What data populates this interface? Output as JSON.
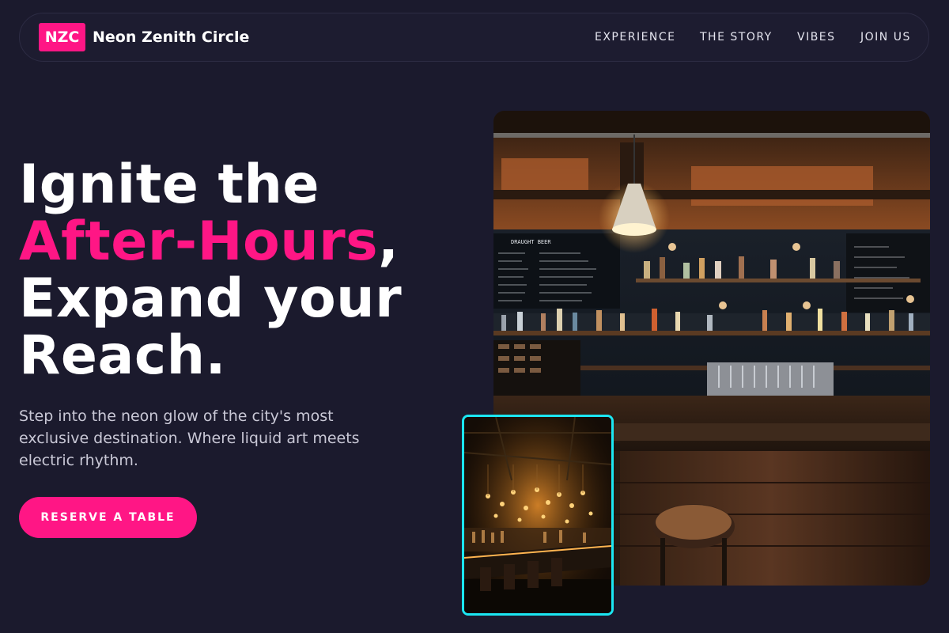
{
  "nav": {
    "logo_badge": "NZC",
    "brand_name": "Neon Zenith Circle",
    "links": [
      {
        "label": "EXPERIENCE"
      },
      {
        "label": "THE STORY"
      },
      {
        "label": "VIBES"
      },
      {
        "label": "JOIN US"
      }
    ]
  },
  "hero": {
    "headline_line1": "Ignite the",
    "headline_accent": "After-Hours",
    "headline_comma": ",",
    "headline_line3": "Expand your",
    "headline_line4": "Reach.",
    "subtext": "Step into the neon glow of the city's most exclusive destination. Where liquid art meets electric rhythm.",
    "cta_label": "RESERVE A TABLE"
  },
  "images": {
    "main": {
      "board_heading": "DRAUGHT BEER"
    },
    "colors": {
      "accent": "#ff1685",
      "frame": "#1be6f2",
      "background": "#1b1a2d"
    }
  }
}
